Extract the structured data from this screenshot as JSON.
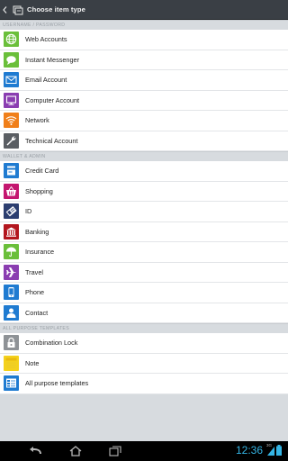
{
  "header": {
    "title": "Choose item type"
  },
  "sections": [
    {
      "title": "USERNAME / PASSWORD",
      "items": [
        {
          "label": "Web Accounts",
          "icon": "globe-icon",
          "color": "#6abf3a"
        },
        {
          "label": "Instant Messenger",
          "icon": "chat-bubble-icon",
          "color": "#6abf3a"
        },
        {
          "label": "Email Account",
          "icon": "envelope-icon",
          "color": "#1f7bd1"
        },
        {
          "label": "Computer Account",
          "icon": "monitor-icon",
          "color": "#8a3db1"
        },
        {
          "label": "Network",
          "icon": "wifi-icon",
          "color": "#f07f1a"
        },
        {
          "label": "Technical Account",
          "icon": "wrench-icon",
          "color": "#5a5e63"
        }
      ]
    },
    {
      "title": "WALLET & ADMIN",
      "items": [
        {
          "label": "Credit Card",
          "icon": "credit-card-icon",
          "color": "#1f7bd1"
        },
        {
          "label": "Shopping",
          "icon": "shopping-basket-icon",
          "color": "#c4166f"
        },
        {
          "label": "ID",
          "icon": "id-card-icon",
          "color": "#2c3e70"
        },
        {
          "label": "Banking",
          "icon": "bank-icon",
          "color": "#b3161e"
        },
        {
          "label": "Insurance",
          "icon": "umbrella-icon",
          "color": "#6abf3a"
        },
        {
          "label": "Travel",
          "icon": "airplane-icon",
          "color": "#8a3db1"
        },
        {
          "label": "Phone",
          "icon": "phone-icon",
          "color": "#1f7bd1"
        },
        {
          "label": "Contact",
          "icon": "person-icon",
          "color": "#1f7bd1"
        }
      ]
    },
    {
      "title": "ALL PURPOSE TEMPLATES",
      "items": [
        {
          "label": "Combination Lock",
          "icon": "padlock-icon",
          "color": "#8e9296"
        },
        {
          "label": "Note",
          "icon": "sticky-note-icon",
          "color": "#f4d11c"
        },
        {
          "label": "All purpose templates",
          "icon": "template-icon",
          "color": "#1f7bd1"
        }
      ]
    }
  ],
  "statusbar": {
    "time": "12:36",
    "signal_label": "3G"
  },
  "colors": {
    "actionbar": "#3a3f45",
    "accent": "#35b5e5"
  }
}
